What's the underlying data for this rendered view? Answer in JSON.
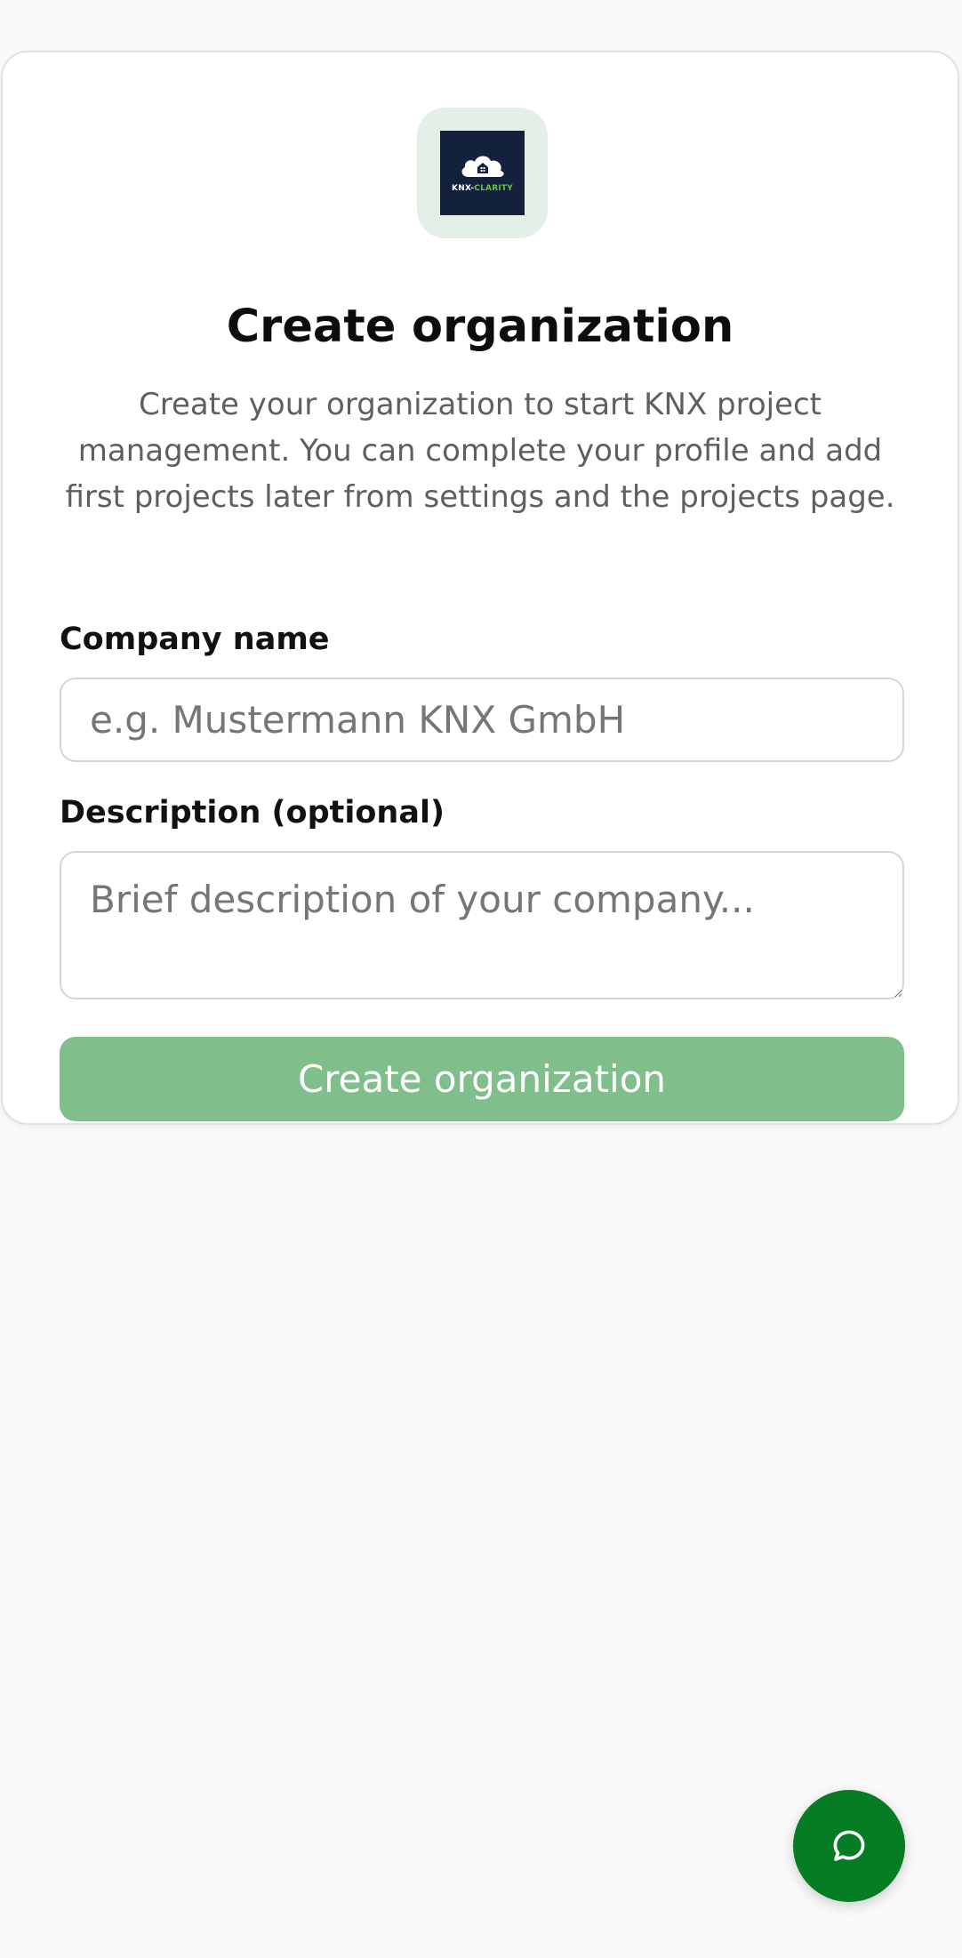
{
  "logo": {
    "icon": "cloud-house-icon",
    "text_part1": "KNX-",
    "text_part2": "CLARITY",
    "colors": {
      "background": "#13213d",
      "accent": "#6cc04a",
      "badge": "#e4efe7"
    }
  },
  "header": {
    "title": "Create organization",
    "subtitle": "Create your organization to start KNX project management. You can complete your profile and add first projects later from settings and the projects page."
  },
  "form": {
    "company_label": "Company name",
    "company_placeholder": "e.g. Mustermann KNX GmbH",
    "company_value": "",
    "description_label": "Description (optional)",
    "description_placeholder": "Brief description of your company...",
    "description_value": "",
    "submit_label": "Create organization"
  },
  "chat": {
    "icon": "chat-bubble-icon",
    "color": "#067d24"
  },
  "colors": {
    "page_background": "#f9f9f9",
    "button_disabled": "#80be8c",
    "primary_green": "#067d24"
  }
}
